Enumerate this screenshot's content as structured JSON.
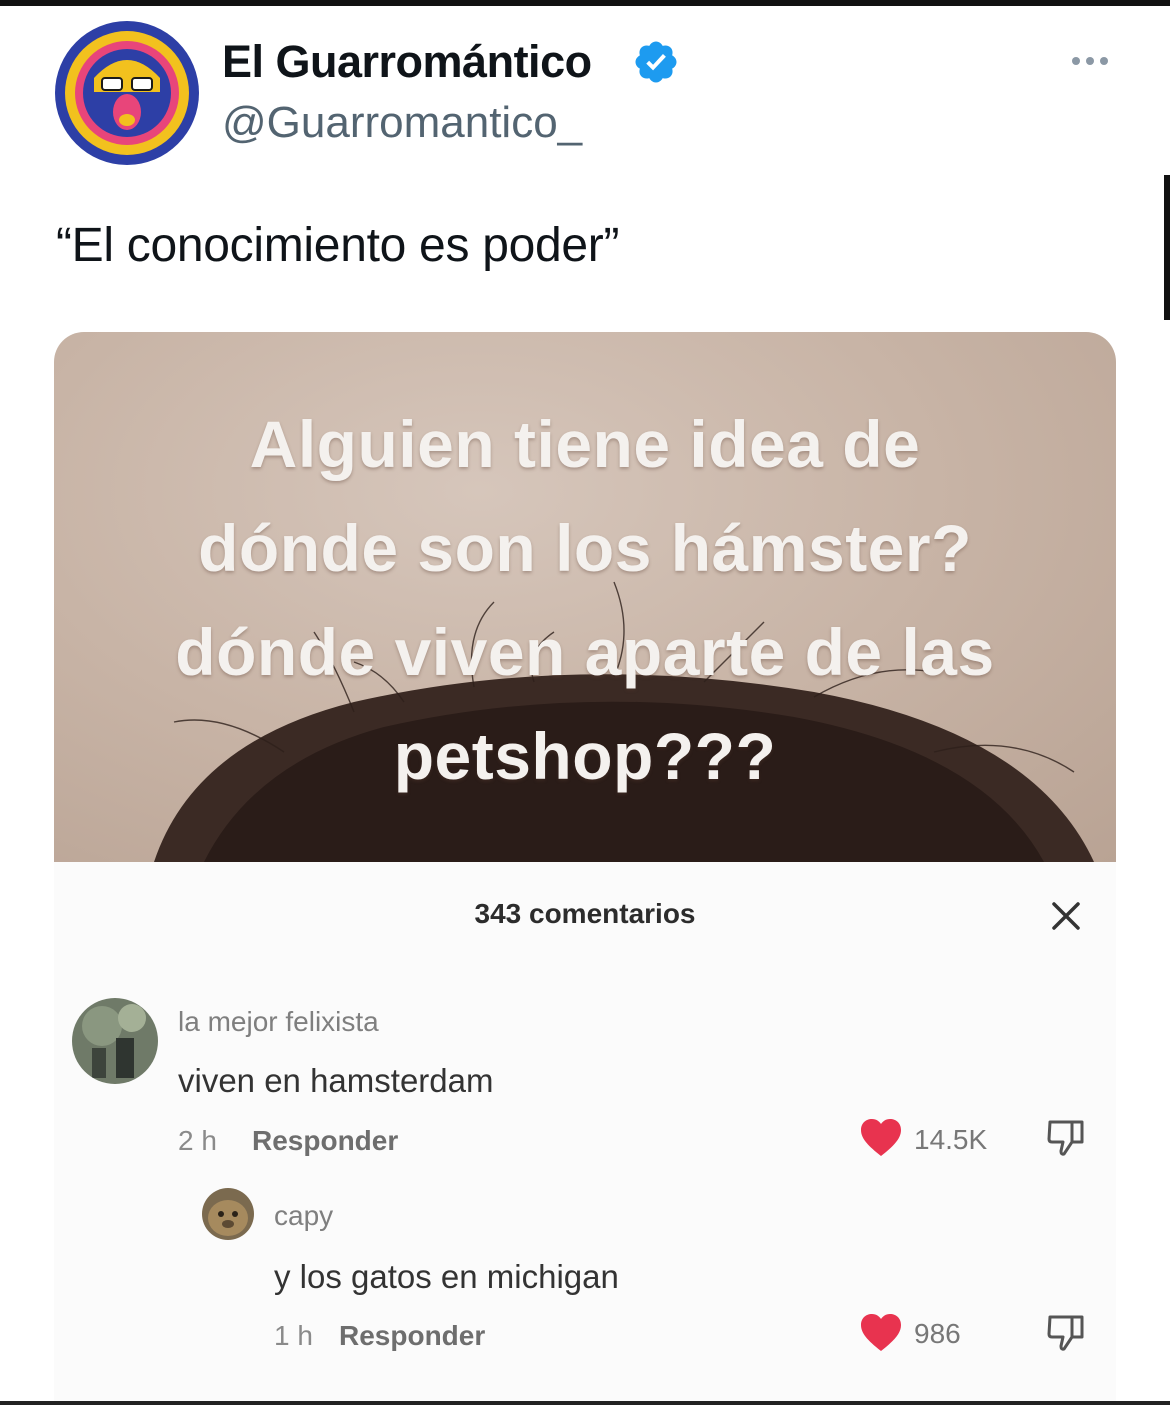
{
  "tweet": {
    "author_name": "El Guarromántico",
    "author_handle": "@Guarromantico_",
    "verified": true,
    "text": "“El conocimiento es poder”",
    "accent_color": "#1d9bf0"
  },
  "media": {
    "caption_lines": [
      "Alguien tiene idea de",
      "dónde son los hámster?",
      "dónde viven aparte de las",
      "petshop???"
    ],
    "comments_header": "343 comentarios",
    "comments": [
      {
        "user": "la mejor felixista",
        "text": "viven en hamsterdam",
        "time": "2 h",
        "reply_label": "Responder",
        "likes": "14.5K"
      },
      {
        "user": "capy",
        "text": "y los gatos en michigan",
        "time": "1 h",
        "reply_label": "Responder",
        "likes": "986"
      }
    ],
    "like_color": "#e8334f"
  }
}
